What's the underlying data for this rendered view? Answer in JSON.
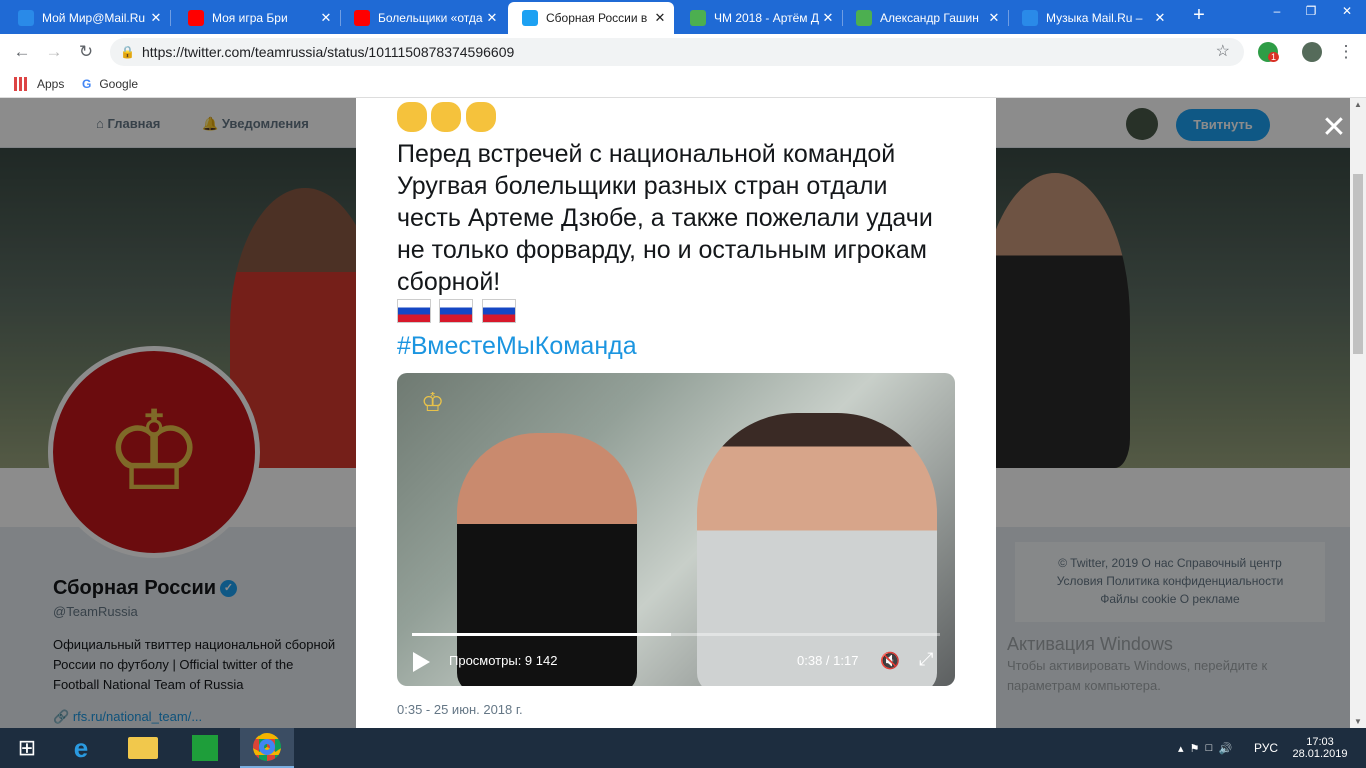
{
  "browser": {
    "tabs": [
      {
        "title": "Мой Мир@Mail.Ru",
        "favicon_color": "#2a8ae8",
        "active": false
      },
      {
        "title": "Моя игра Бри",
        "favicon_color": "#ff0000",
        "active": false
      },
      {
        "title": "Болельщики «отда",
        "favicon_color": "#ff0000",
        "active": false
      },
      {
        "title": "Сборная России в",
        "favicon_color": "#1da1f2",
        "active": true
      },
      {
        "title": "ЧМ 2018 - Артём Д",
        "favicon_color": "#4caf50",
        "active": false
      },
      {
        "title": "Александр Гашин",
        "favicon_color": "#4caf50",
        "active": false
      },
      {
        "title": "Музыка Mail.Ru –",
        "favicon_color": "#2a8ae8",
        "active": false
      }
    ],
    "url": "https://twitter.com/teamrussia/status/1011150878374596609",
    "ext_badge": "1",
    "bookmarks": [
      "Apps",
      "Google"
    ]
  },
  "twitter_nav": {
    "home": "Главная",
    "notifications": "Уведомления",
    "tweet_button": "Твитнуть"
  },
  "profile": {
    "name": "Сборная России",
    "handle": "@TeamRussia",
    "bio": "Официальный твиттер национальной сборной России по футболу | Official twitter of the Football National Team of Russia",
    "link": "rfs.ru/national_team/..."
  },
  "footer": {
    "line1": "© Twitter, 2019   О нас   Справочный центр",
    "line2": "Условия   Политика конфиденциальности",
    "line3": "Файлы cookie   О рекламе"
  },
  "windows_activation": {
    "title": "Активация Windows",
    "text": "Чтобы активировать Windows, перейдите к параметрам компьютера."
  },
  "tweet": {
    "text": "Перед встречей с национальной командой Уругвая болельщики разных стран отдали честь Артеме Дзюбе, а также пожелали удачи не только форварду, но и остальным игрокам сборной!",
    "hashtag": "#ВместеМыКоманда",
    "video": {
      "views_label": "Просмотры: 9 142",
      "time": "0:38 / 1:17",
      "progress": 0.49
    },
    "date": "0:35 - 25 июн. 2018 г."
  },
  "taskbar": {
    "lang": "РУС",
    "time": "17:03",
    "date": "28.01.2019"
  }
}
